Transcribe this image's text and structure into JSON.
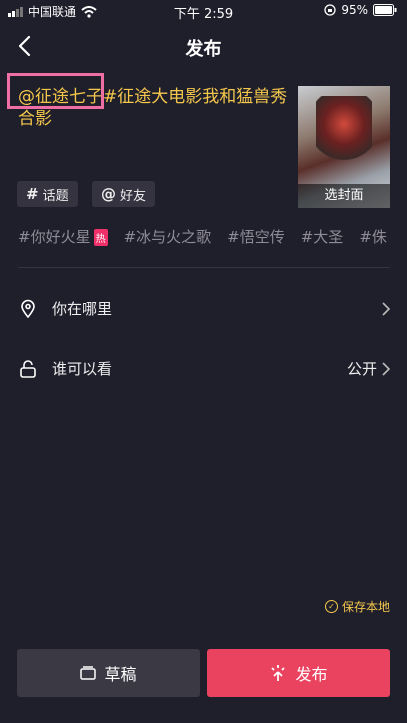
{
  "status_bar": {
    "carrier": "中国联通",
    "time": "下午 2:59",
    "battery": "95%"
  },
  "nav": {
    "title": "发布"
  },
  "caption": {
    "mention": "@征途七子",
    "hashtag": "#征途大电影我和猛兽秀合影"
  },
  "cover": {
    "label": "选封面"
  },
  "chips": {
    "topic": "话题",
    "friend": "好友"
  },
  "tags": [
    {
      "text": "#你好火星",
      "badge": "热"
    },
    {
      "text": "#冰与火之歌"
    },
    {
      "text": "#悟空传"
    },
    {
      "text": "#大圣"
    },
    {
      "text": "#侏"
    }
  ],
  "location_row": {
    "label": "你在哪里"
  },
  "visibility_row": {
    "label": "谁可以看",
    "value": "公开"
  },
  "save_local": "保存本地",
  "buttons": {
    "draft": "草稿",
    "publish": "发布"
  },
  "colors": {
    "background": "#1f1e2b",
    "accent_yellow": "#f5c84c",
    "publish_red": "#ea4360",
    "highlight_pink": "#ef6fa5"
  }
}
